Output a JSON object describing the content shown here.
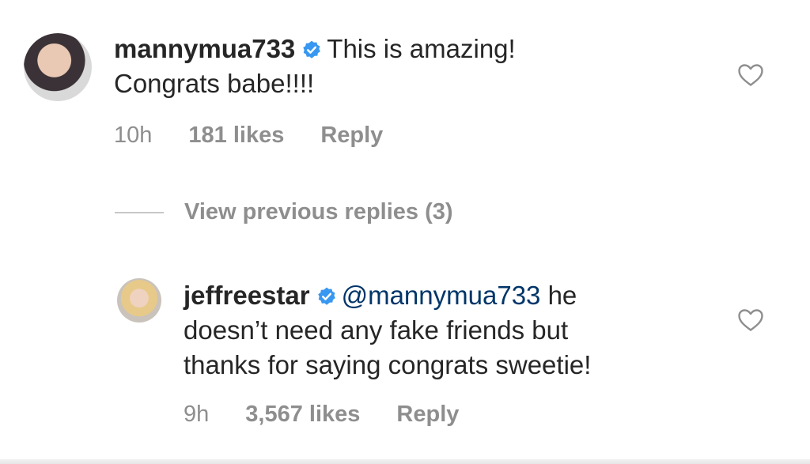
{
  "comments": [
    {
      "username": "mannymua733",
      "text_line1": "This is amazing!",
      "text_line2": "Congrats babe!!!!",
      "time": "10h",
      "likes": "181 likes",
      "reply_label": "Reply"
    },
    {
      "username": "jeffreestar",
      "mention": "@mannymua733",
      "text_after_mention": " he",
      "text_line2": "doesn’t need any fake friends but",
      "text_line3": "thanks for saying congrats sweetie!",
      "time": "9h",
      "likes": "3,567 likes",
      "reply_label": "Reply"
    }
  ],
  "view_previous": "View previous replies (3)",
  "icons": {
    "verified": "verified-badge-icon",
    "like": "heart-icon"
  },
  "colors": {
    "verified_blue": "#3897f0",
    "meta_gray": "#8e8e8e",
    "mention_blue": "#003569"
  }
}
